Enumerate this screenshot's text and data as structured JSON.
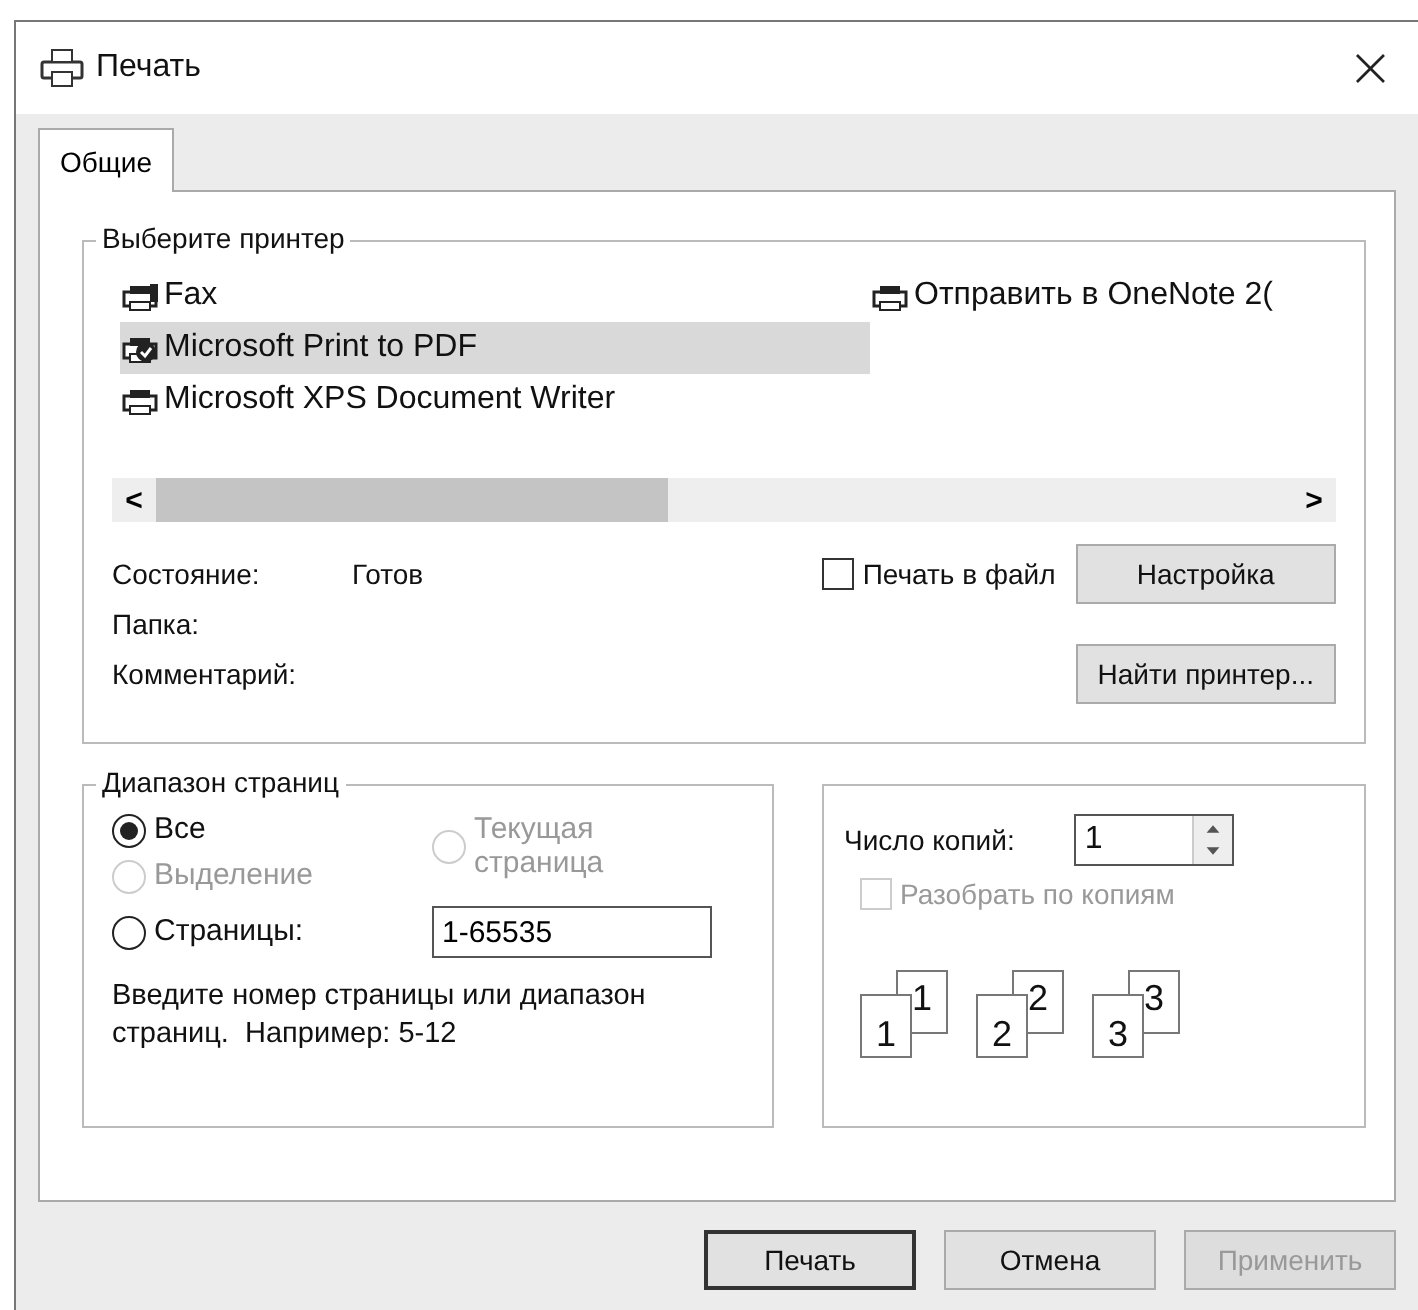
{
  "window": {
    "title": "Печать",
    "close": "×"
  },
  "tabs": [
    {
      "label": "Общие",
      "selected": true
    }
  ],
  "printer_group": {
    "title": "Выберите принтер",
    "printers": [
      {
        "name": "Fax",
        "kind": "fax",
        "selected": false
      },
      {
        "name": "Microsoft Print to PDF",
        "kind": "default",
        "selected": true
      },
      {
        "name": "Microsoft XPS Document Writer",
        "kind": "printer",
        "selected": false
      },
      {
        "name": "Отправить в OneNote 2(",
        "kind": "printer",
        "selected": false
      }
    ],
    "scroll_left": "<",
    "scroll_right": ">",
    "status_label": "Состояние:",
    "status_value": "Готов",
    "folder_label": "Папка:",
    "comment_label": "Комментарий:",
    "print_to_file": {
      "label": "Печать в файл",
      "checked": false,
      "disabled": false
    },
    "buttons": [
      {
        "label": "Настройка"
      },
      {
        "label": "Найти принтер..."
      }
    ]
  },
  "page_range": {
    "title": "Диапазон страниц",
    "options": [
      {
        "label": "Все",
        "selected": true,
        "disabled": false
      },
      {
        "label": "Текущая страница",
        "selected": false,
        "disabled": true
      },
      {
        "label": "Выделение",
        "selected": false,
        "disabled": true
      },
      {
        "label": "Страницы:",
        "selected": false,
        "disabled": false
      }
    ],
    "pages_value": "1-65535",
    "hint": "Введите номер страницы или диапазон страниц.  Например: 5-12"
  },
  "copies": {
    "label": "Число копий:",
    "value": "1",
    "collate": {
      "label": "Разобрать по копиям",
      "checked": false,
      "disabled": true
    },
    "collate_sets": [
      {
        "front": "1",
        "back": "1"
      },
      {
        "front": "2",
        "back": "2"
      },
      {
        "front": "3",
        "back": "3"
      }
    ]
  },
  "footer_buttons": [
    {
      "label": "Печать",
      "default": true,
      "disabled": false
    },
    {
      "label": "Отмена",
      "default": false,
      "disabled": false
    },
    {
      "label": "Применить",
      "default": false,
      "disabled": true
    }
  ]
}
